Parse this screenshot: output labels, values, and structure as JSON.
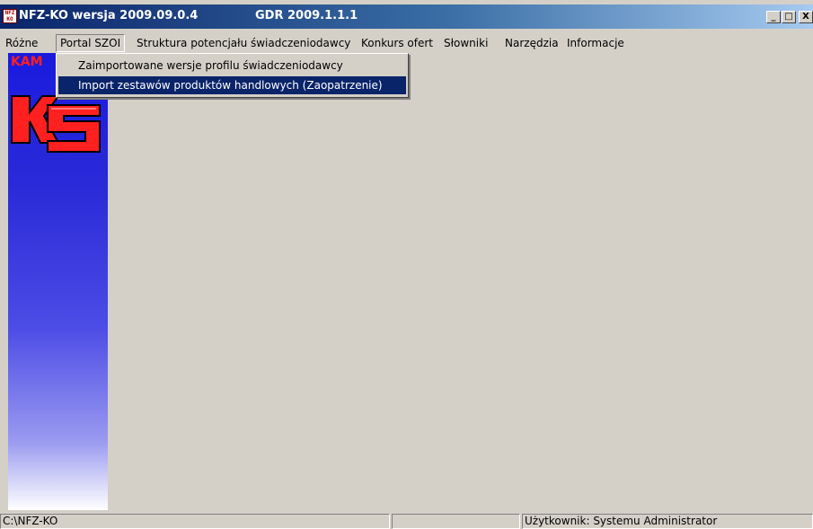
{
  "window": {
    "icon_text": "NFZ KO",
    "title": "NFZ-KO wersja 2009.09.0.4",
    "gdr": "GDR 2009.1.1.1",
    "minimize_label": "_",
    "maximize_label": "□",
    "close_label": "X"
  },
  "menu": {
    "items": [
      {
        "label": "Różne"
      },
      {
        "label": "Portal SZOI"
      },
      {
        "label": "Struktura potencjału świadczeniodawcy"
      },
      {
        "label": "Konkurs ofert"
      },
      {
        "label": "Słowniki"
      },
      {
        "label": "Narzędzia"
      },
      {
        "label": "Informacje"
      }
    ]
  },
  "dropdown": {
    "items": [
      {
        "label": "Zaimportowane wersje profilu świadczeniodawcy"
      },
      {
        "label": "Import zestawów produktów handlowych (Zaopatrzenie)",
        "highlighted": true
      }
    ]
  },
  "banner": {
    "text": "KAM"
  },
  "statusbar": {
    "path": "C:\\NFZ-KO",
    "middle": "",
    "user": "Użytkownik:  Systemu Administrator"
  },
  "colors": {
    "face": "#d4d0c8",
    "title_active": "#0a246a",
    "highlight": "#0a246a",
    "banner_blue": "#1a1adf",
    "logo_red": "#ff2020"
  }
}
